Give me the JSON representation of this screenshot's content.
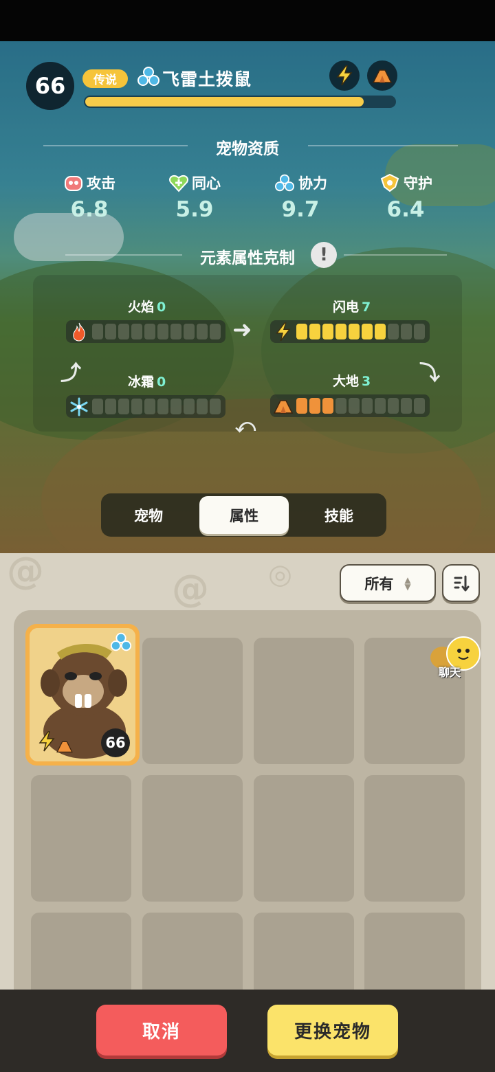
{
  "pet": {
    "level": "66",
    "rarity": "传说",
    "name": "飞雷土拨鼠",
    "exp_fraction": 0.9,
    "elements": [
      "lightning-icon",
      "earth-icon"
    ]
  },
  "quality": {
    "title": "宠物资质",
    "stats": [
      {
        "label": "攻击",
        "value": "6.8",
        "icon": "attack-icon"
      },
      {
        "label": "同心",
        "value": "5.9",
        "icon": "heart-icon"
      },
      {
        "label": "协力",
        "value": "9.7",
        "icon": "cooperation-icon"
      },
      {
        "label": "守护",
        "value": "6.4",
        "icon": "guard-icon"
      }
    ]
  },
  "elements": {
    "title": "元素属性克制",
    "max_level": 10,
    "items": [
      {
        "label": "火焰",
        "value": "0",
        "level": 0,
        "color": "#f0923a",
        "icon": "fire-icon"
      },
      {
        "label": "闪电",
        "value": "7",
        "level": 7,
        "color": "#f7d23e",
        "icon": "lightning-icon"
      },
      {
        "label": "冰霜",
        "value": "0",
        "level": 0,
        "color": "#7ad6f0",
        "icon": "frost-icon"
      },
      {
        "label": "大地",
        "value": "3",
        "level": 3,
        "color": "#f0923a",
        "icon": "earth-icon"
      }
    ]
  },
  "tabs": [
    {
      "label": "宠物",
      "active": false
    },
    {
      "label": "属性",
      "active": true
    },
    {
      "label": "技能",
      "active": false
    }
  ],
  "filter": {
    "label": "所有"
  },
  "chat": {
    "label": "聊天"
  },
  "card": {
    "level": "66"
  },
  "actions": {
    "cancel": "取消",
    "switch": "更换宠物"
  }
}
